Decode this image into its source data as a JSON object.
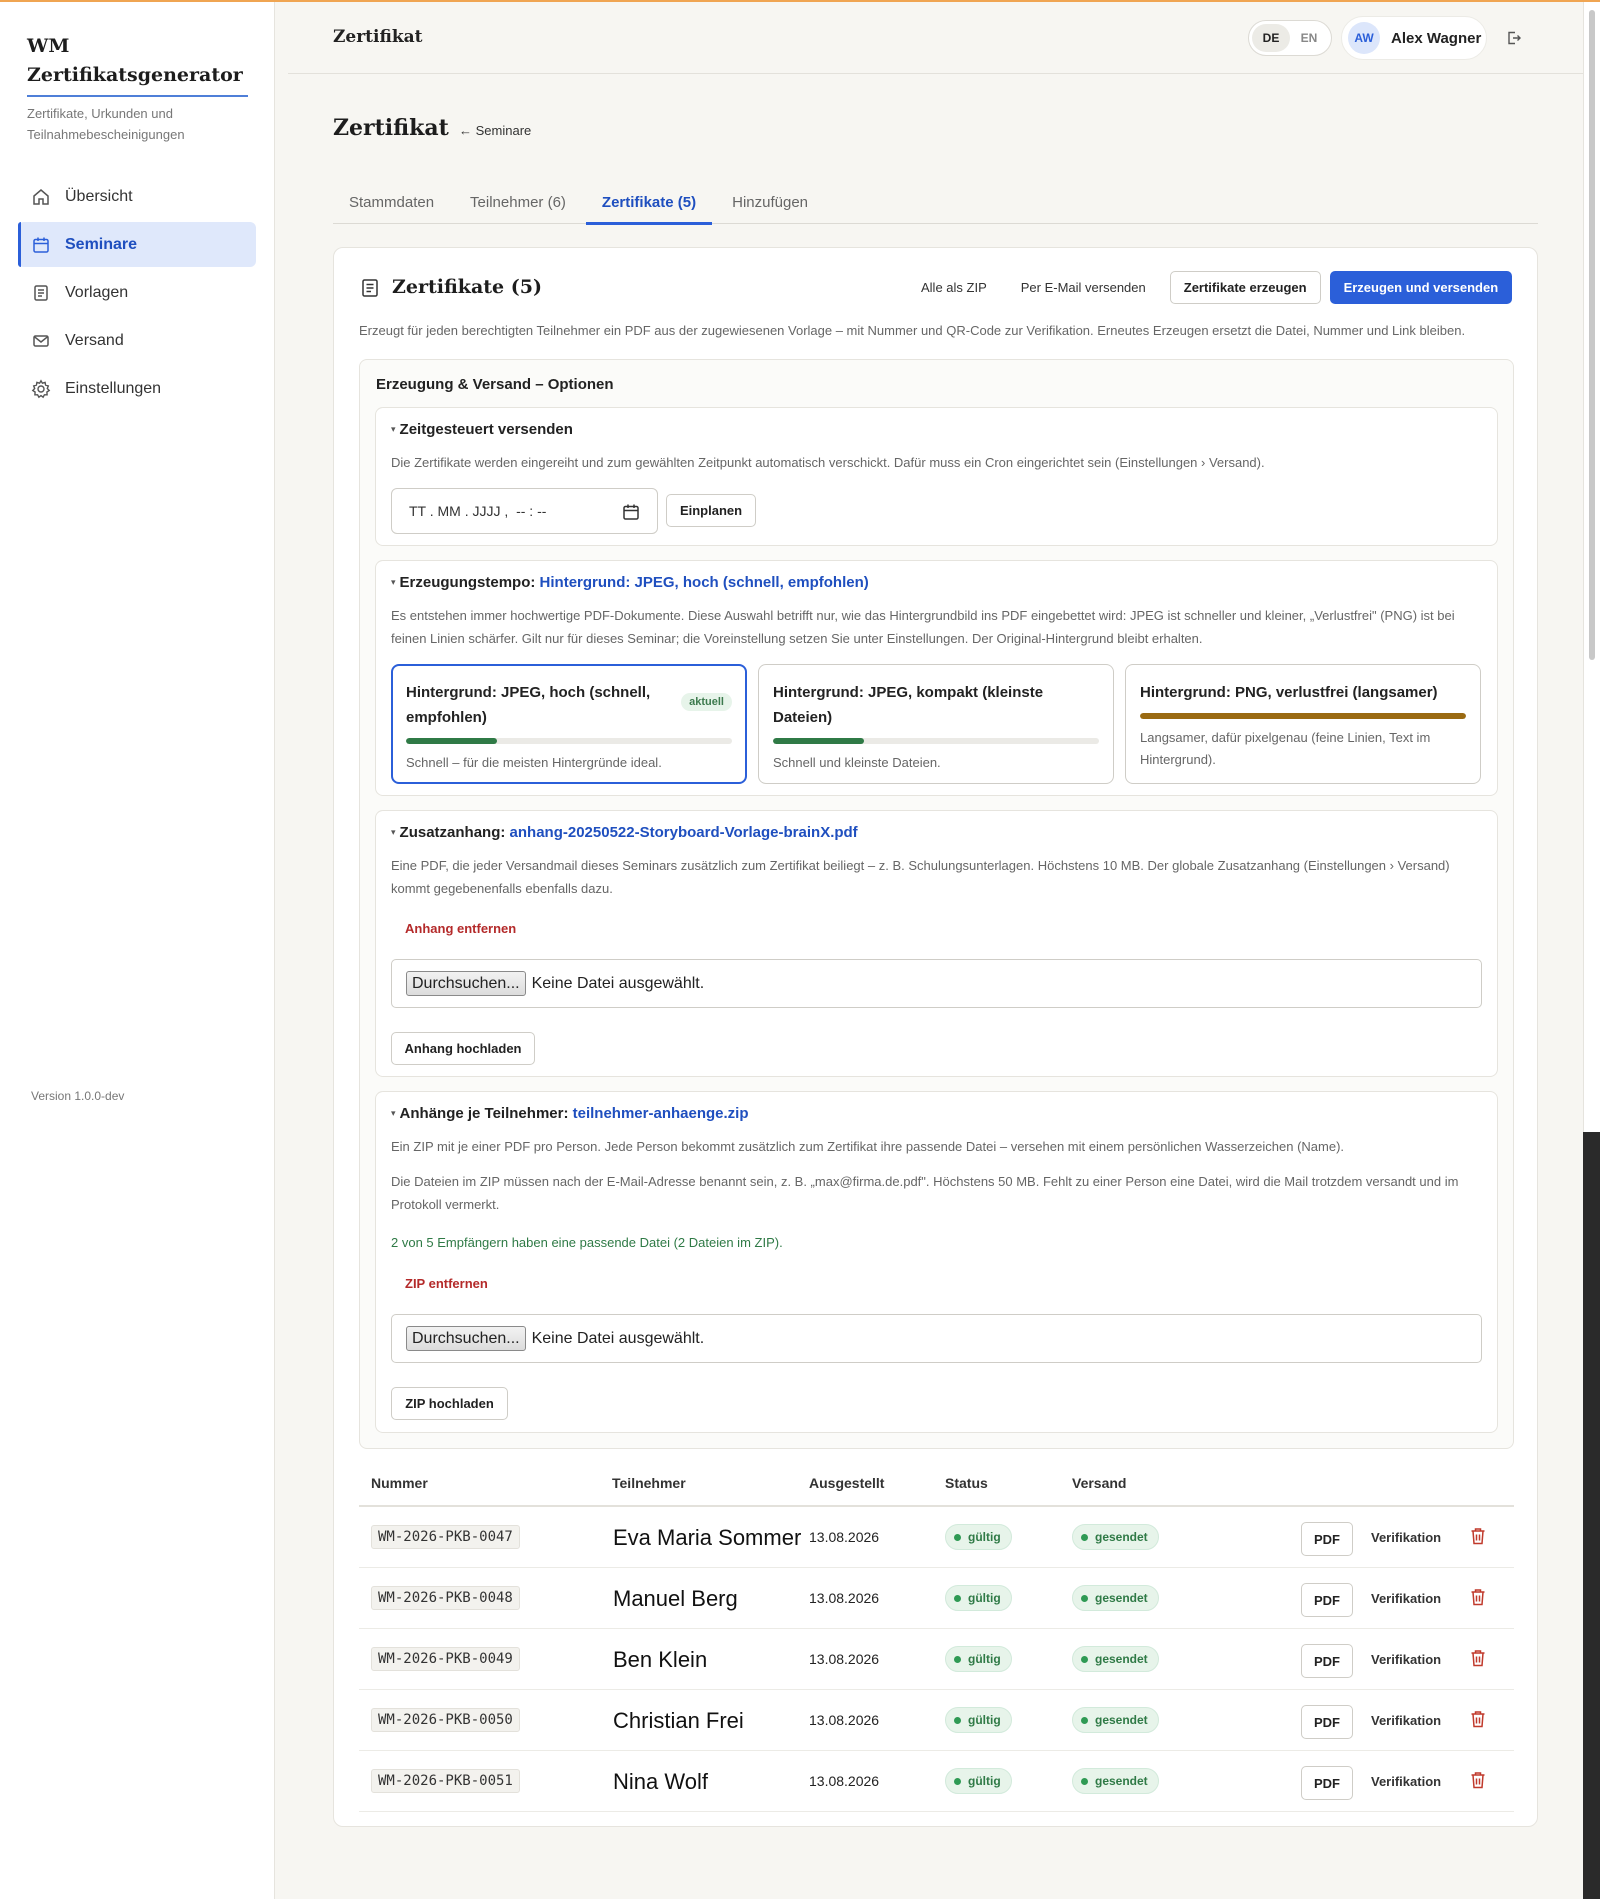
{
  "app": {
    "brand": "WM Zertifikatsgenerator",
    "brand_sub": "Zertifikate, Urkunden und Teilnahmebescheinigungen",
    "version": "Version 1.0.0-dev"
  },
  "sidebar": {
    "items": [
      {
        "label": "Übersicht",
        "icon": "home-icon",
        "active": false
      },
      {
        "label": "Seminare",
        "icon": "calendar-icon",
        "active": true
      },
      {
        "label": "Vorlagen",
        "icon": "document-icon",
        "active": false
      },
      {
        "label": "Versand",
        "icon": "mail-icon",
        "active": false
      },
      {
        "label": "Einstellungen",
        "icon": "gear-icon",
        "active": false
      }
    ]
  },
  "header": {
    "title": "Zertifikat",
    "lang_de": "DE",
    "lang_en": "EN",
    "active_lang": "DE",
    "user_initials": "AW",
    "user_name": "Alex Wagner"
  },
  "page": {
    "title": "Zertifikat",
    "back_label": "← Seminare",
    "tabs": [
      {
        "label": "Stammdaten",
        "active": false
      },
      {
        "label": "Teilnehmer (6)",
        "active": false
      },
      {
        "label": "Zertifikate (5)",
        "active": true
      },
      {
        "label": "Hinzufügen",
        "active": false
      }
    ]
  },
  "card": {
    "title": "Zertifikate (5)",
    "actions": {
      "zip": "Alle als ZIP",
      "email": "Per E-Mail versenden",
      "generate": "Zertifikate erzeugen",
      "generate_send": "Erzeugen und versenden"
    },
    "description": "Erzeugt für jeden berechtigten Teilnehmer ein PDF aus der zugewiesenen Vorlage – mit Nummer und QR-Code zur Verifikation. Erneutes Erzeugen ersetzt die Datei, Nummer und Link bleiben."
  },
  "options": {
    "title": "Erzeugung & Versand – Optionen",
    "schedule": {
      "heading": "Zeitgesteuert versenden",
      "text": "Die Zertifikate werden eingereiht und zum gewählten Zeitpunkt automatisch verschickt. Dafür muss ein Cron eingerichtet sein (Einstellungen › Versand).",
      "date_placeholder": "TT . MM . JJJJ ,  -- : --",
      "button": "Einplanen"
    },
    "speed": {
      "heading": "Erzeugungstempo:",
      "current": "Hintergrund: JPEG, hoch (schnell, empfohlen)",
      "text": "Es entstehen immer hochwertige PDF-Dokumente. Diese Auswahl betrifft nur, wie das Hintergrundbild ins PDF eingebettet wird: JPEG ist schneller und kleiner, „Verlustfrei\" (PNG) ist bei feinen Linien schärfer. Gilt nur für dieses Seminar; die Voreinstellung setzen Sie unter Einstellungen. Der Original-Hintergrund bleibt erhalten.",
      "choices": [
        {
          "title": "Hintergrund: JPEG, hoch (schnell, empfohlen)",
          "badge": "aktuell",
          "desc": "Schnell – für die meisten Hintergründe ideal.",
          "level": 0.28,
          "color": "#2f7a46",
          "selected": true
        },
        {
          "title": "Hintergrund: JPEG, kompakt (kleinste Dateien)",
          "badge": "",
          "desc": "Schnell und kleinste Dateien.",
          "level": 0.28,
          "color": "#2f7a46",
          "selected": false
        },
        {
          "title": "Hintergrund: PNG, verlustfrei (langsamer)",
          "badge": "",
          "desc": "Langsamer, dafür pixelgenau (feine Linien, Text im Hintergrund).",
          "level": 1.0,
          "color": "#9a6a12",
          "selected": false
        }
      ]
    },
    "attachment": {
      "heading": "Zusatzanhang:",
      "file": "anhang-20250522-Storyboard-Vorlage-brainX.pdf",
      "text": "Eine PDF, die jeder Versandmail dieses Seminars zusätzlich zum Zertifikat beiliegt – z. B. Schulungsunterlagen. Höchstens 10 MB. Der globale Zusatzanhang (Einstellungen › Versand) kommt gegebenenfalls ebenfalls dazu.",
      "remove": "Anhang entfernen",
      "browse": "Durchsuchen...",
      "no_file": "Keine Datei ausgewählt.",
      "upload": "Anhang hochladen"
    },
    "per_participant": {
      "heading": "Anhänge je Teilnehmer:",
      "file": "teilnehmer-anhaenge.zip",
      "text1": "Ein ZIP mit je einer PDF pro Person. Jede Person bekommt zusätzlich zum Zertifikat ihre passende Datei – versehen mit einem persönlichen Wasserzeichen (Name).",
      "text2": "Die Dateien im ZIP müssen nach der E-Mail-Adresse benannt sein, z. B. „max@firma.de.pdf\". Höchstens 50 MB. Fehlt zu einer Person eine Datei, wird die Mail trotzdem versandt und im Protokoll vermerkt.",
      "match": "2 von 5 Empfängern haben eine passende Datei (2 Dateien im ZIP).",
      "remove": "ZIP entfernen",
      "browse": "Durchsuchen...",
      "no_file": "Keine Datei ausgewählt.",
      "upload": "ZIP hochladen"
    }
  },
  "table": {
    "columns": [
      "Nummer",
      "Teilnehmer",
      "Ausgestellt",
      "Status",
      "Versand"
    ],
    "pdf_label": "PDF",
    "verify_label": "Verifikation",
    "rows": [
      {
        "number": "WM-2026-PKB-0047",
        "name": "Eva Maria Sommer",
        "date": "13.08.2026",
        "status": "gültig",
        "send": "gesendet"
      },
      {
        "number": "WM-2026-PKB-0048",
        "name": "Manuel Berg",
        "date": "13.08.2026",
        "status": "gültig",
        "send": "gesendet"
      },
      {
        "number": "WM-2026-PKB-0049",
        "name": "Ben Klein",
        "date": "13.08.2026",
        "status": "gültig",
        "send": "gesendet"
      },
      {
        "number": "WM-2026-PKB-0050",
        "name": "Christian Frei",
        "date": "13.08.2026",
        "status": "gültig",
        "send": "gesendet"
      },
      {
        "number": "WM-2026-PKB-0051",
        "name": "Nina Wolf",
        "date": "13.08.2026",
        "status": "gültig",
        "send": "gesendet"
      }
    ]
  }
}
